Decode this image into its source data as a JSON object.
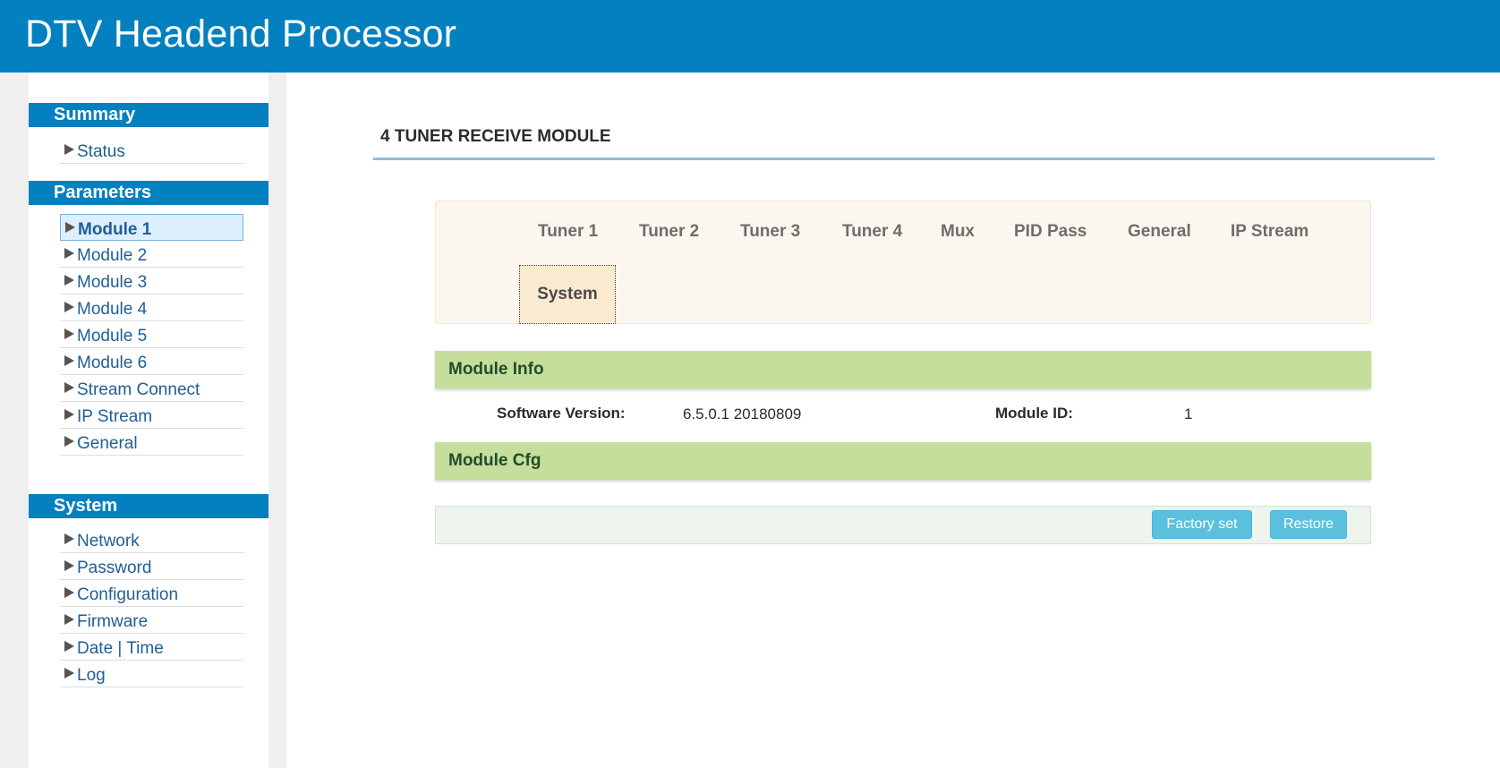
{
  "header": {
    "title": "DTV Headend Processor"
  },
  "colors": {
    "brand": "#0280bf",
    "section": "#c5de9b",
    "button": "#5bc0de"
  },
  "sidebar": {
    "summary": {
      "heading": "Summary",
      "items": [
        "Status"
      ]
    },
    "parameters": {
      "heading": "Parameters",
      "items": [
        "Module 1",
        "Module 2",
        "Module 3",
        "Module 4",
        "Module 5",
        "Module 6",
        "Stream Connect",
        "IP Stream",
        "General"
      ],
      "active": "Module 1"
    },
    "system": {
      "heading": "System",
      "items": [
        "Network",
        "Password",
        "Configuration",
        "Firmware",
        "Date | Time",
        "Log"
      ]
    }
  },
  "main": {
    "title": "4 TUNER RECEIVE MODULE",
    "tabs": [
      "Tuner 1",
      "Tuner 2",
      "Tuner 3",
      "Tuner 4",
      "Mux",
      "PID Pass",
      "General",
      "IP Stream",
      "System"
    ],
    "selected_tab": "System",
    "module_info": {
      "heading": "Module Info",
      "software_version_label": "Software Version:",
      "software_version": "6.5.0.1 20180809",
      "module_id_label": "Module ID:",
      "module_id": "1"
    },
    "module_cfg": {
      "heading": "Module Cfg"
    },
    "buttons": {
      "factory_set": "Factory set",
      "restore": "Restore"
    }
  }
}
